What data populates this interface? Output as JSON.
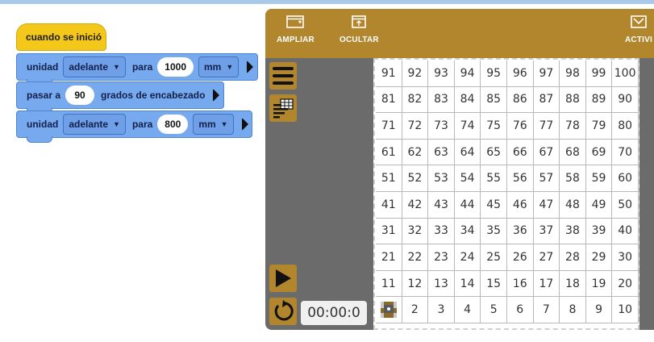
{
  "blocks": {
    "hat": "cuando se inició",
    "move1": {
      "label": "unidad",
      "direction": "adelante",
      "para": "para",
      "distance": "1000",
      "unit": "mm"
    },
    "turn": {
      "label": "pasar a",
      "degrees": "90",
      "suffix": "grados de encabezado"
    },
    "move2": {
      "label": "unidad",
      "direction": "adelante",
      "para": "para",
      "distance": "800",
      "unit": "mm"
    }
  },
  "toolbar": {
    "expand_label": "AMPLIAR",
    "hide_label": "OCULTAR",
    "activity_label": "ACTIVI"
  },
  "timer": "00:00:0",
  "grid": {
    "rows": [
      [
        "91",
        "92",
        "93",
        "94",
        "95",
        "96",
        "97",
        "98",
        "99",
        "100"
      ],
      [
        "81",
        "82",
        "83",
        "84",
        "85",
        "86",
        "87",
        "88",
        "89",
        "90"
      ],
      [
        "71",
        "72",
        "73",
        "74",
        "75",
        "76",
        "77",
        "78",
        "79",
        "80"
      ],
      [
        "61",
        "62",
        "63",
        "64",
        "65",
        "66",
        "67",
        "68",
        "69",
        "70"
      ],
      [
        "51",
        "52",
        "53",
        "54",
        "55",
        "56",
        "57",
        "58",
        "59",
        "60"
      ],
      [
        "41",
        "42",
        "43",
        "44",
        "45",
        "46",
        "47",
        "48",
        "49",
        "50"
      ],
      [
        "31",
        "32",
        "33",
        "34",
        "35",
        "36",
        "37",
        "38",
        "39",
        "40"
      ],
      [
        "21",
        "22",
        "23",
        "24",
        "25",
        "26",
        "27",
        "28",
        "29",
        "30"
      ],
      [
        "11",
        "12",
        "13",
        "14",
        "15",
        "16",
        "17",
        "18",
        "19",
        "20"
      ],
      [
        "",
        "2",
        "3",
        "4",
        "5",
        "6",
        "7",
        "8",
        "9",
        "10"
      ]
    ]
  },
  "icons": {
    "menu": "hamburger-icon",
    "table": "table-icon",
    "play": "play-icon",
    "reset": "reset-icon",
    "robot": "robot-icon"
  },
  "colors": {
    "event_block": "#f4c71b",
    "motion_block": "#76a9ee",
    "panel_accent": "#b1862d",
    "panel_bg": "#6b6b6b"
  }
}
